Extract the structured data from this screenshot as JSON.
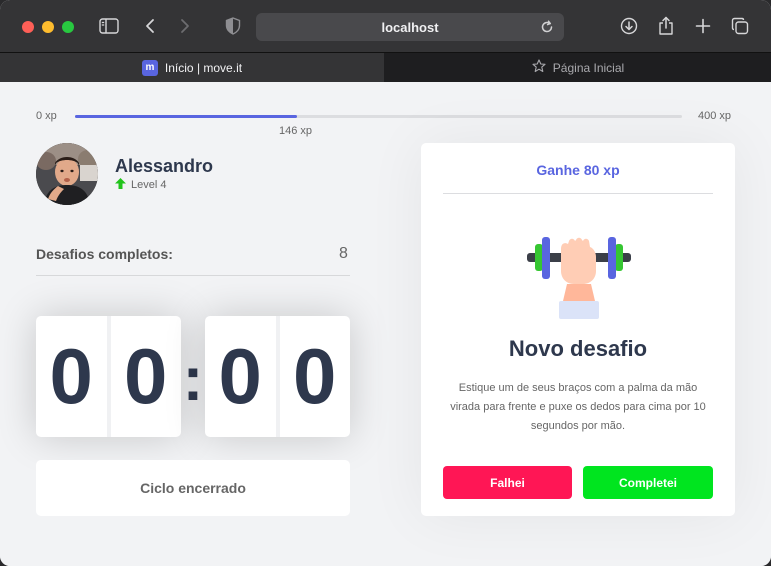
{
  "browser": {
    "url": "localhost",
    "tabs": [
      {
        "label": "Início | move.it",
        "favicon_text": "m",
        "active": true
      },
      {
        "label": "Página Inicial",
        "active": false
      }
    ]
  },
  "experience": {
    "min_label": "0 xp",
    "max_label": "400 xp",
    "current_label": "146 xp",
    "progress_percent": 36.5,
    "bar_color": "#5965e0"
  },
  "profile": {
    "name": "Alessandro",
    "level_label": "Level 4"
  },
  "challenges": {
    "label": "Desafios completos:",
    "count": "8"
  },
  "countdown": {
    "minute_left": "0",
    "minute_right": "0",
    "separator": ":",
    "second_left": "0",
    "second_right": "0"
  },
  "cycle_button": {
    "label": "Ciclo encerrado"
  },
  "challenge_card": {
    "reward": "Ganhe 80 xp",
    "title": "Novo desafio",
    "description": "Estique um de seus braços com a palma da mão virada para frente e puxe os dedos para cima por 10 segundos por mão.",
    "fail_label": "Falhei",
    "complete_label": "Completei",
    "fail_color": "#ff1655",
    "complete_color": "#00e51f"
  }
}
